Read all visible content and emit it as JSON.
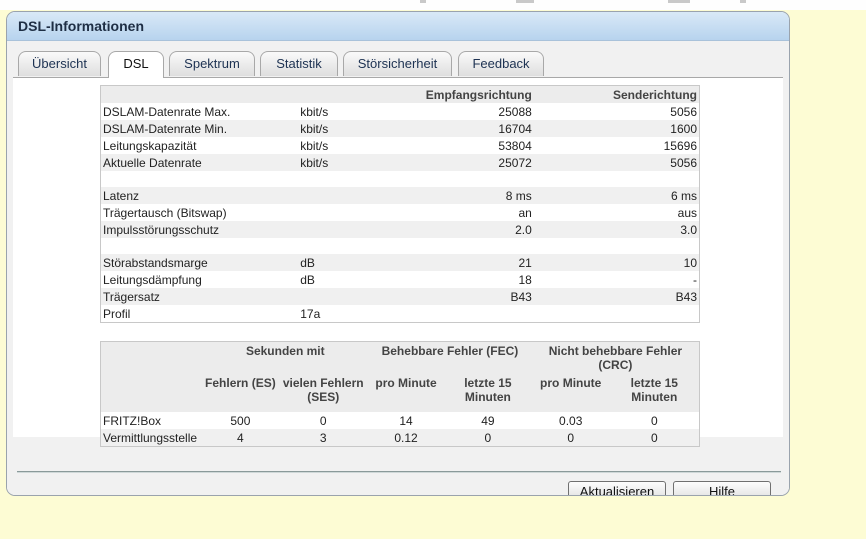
{
  "panel": {
    "title": "DSL-Informationen"
  },
  "tabs": [
    {
      "label": "Übersicht"
    },
    {
      "label": "DSL"
    },
    {
      "label": "Spektrum"
    },
    {
      "label": "Statistik"
    },
    {
      "label": "Störsicherheit"
    },
    {
      "label": "Feedback"
    }
  ],
  "info": {
    "header": {
      "empfang": "Empfangsrichtung",
      "sende": "Senderichtung"
    },
    "rows": [
      {
        "label": "DSLAM-Datenrate Max.",
        "unit": "kbit/s",
        "down": "25088",
        "up": "5056"
      },
      {
        "label": "DSLAM-Datenrate Min.",
        "unit": "kbit/s",
        "down": "16704",
        "up": "1600"
      },
      {
        "label": "Leitungskapazität",
        "unit": "kbit/s",
        "down": "53804",
        "up": "15696"
      },
      {
        "label": "Aktuelle Datenrate",
        "unit": "kbit/s",
        "down": "25072",
        "up": "5056"
      },
      {
        "label": "Latenz",
        "unit": "",
        "down": "8 ms",
        "up": "6 ms"
      },
      {
        "label": "Trägertausch (Bitswap)",
        "unit": "",
        "down": "an",
        "up": "aus"
      },
      {
        "label": "Impulsstörungsschutz",
        "unit": "",
        "down": "2.0",
        "up": "3.0"
      },
      {
        "label": "Störabstandsmarge",
        "unit": "dB",
        "down": "21",
        "up": "10"
      },
      {
        "label": "Leitungsdämpfung",
        "unit": "dB",
        "down": "18",
        "up": "-"
      },
      {
        "label": "Trägersatz",
        "unit": "",
        "down": "B43",
        "up": "B43"
      },
      {
        "label": "Profil",
        "unit": "17a",
        "down": "",
        "up": ""
      }
    ]
  },
  "errors": {
    "group_seconds": "Sekunden mit",
    "group_fec": "Behebbare Fehler (FEC)",
    "group_crc": "Nicht behebbare Fehler (CRC)",
    "col_es": "Fehlern (ES)",
    "col_ses": "vielen Fehlern (SES)",
    "col_fec_min": "pro Minute",
    "col_fec_15": "letzte 15 Minuten",
    "col_crc_min": "pro Minute",
    "col_crc_15": "letzte 15 Minuten",
    "rows": [
      {
        "label": "FRITZ!Box",
        "es": "500",
        "ses": "0",
        "fec_min": "14",
        "fec_15": "49",
        "crc_min": "0.03",
        "crc_15": "0"
      },
      {
        "label": "Vermittlungsstelle",
        "es": "4",
        "ses": "3",
        "fec_min": "0.12",
        "fec_15": "0",
        "crc_min": "0",
        "crc_15": "0"
      }
    ]
  },
  "buttons": {
    "refresh": "Aktualisieren",
    "help": "Hilfe"
  }
}
